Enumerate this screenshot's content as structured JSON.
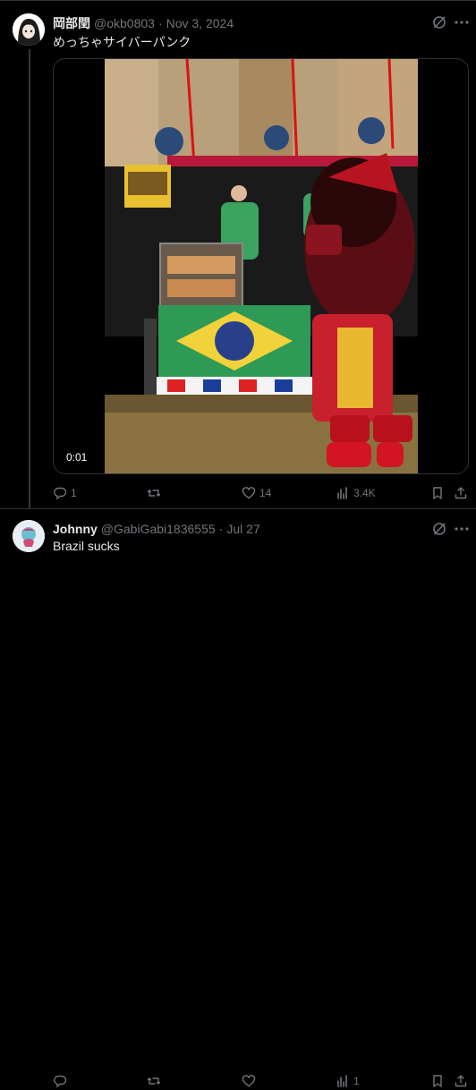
{
  "post1": {
    "name": "岡部閏",
    "handle": "@okb0803",
    "sep": "·",
    "date": "Nov 3, 2024",
    "text": "めっちゃサイバーパンク",
    "video": {
      "timestamp": "0:01",
      "description_icon": "video-thumbnail"
    },
    "actions": {
      "reply": "1",
      "repost": "",
      "like": "14",
      "views": "3.4K"
    }
  },
  "post2": {
    "name": "Johnny",
    "handle": "@GabiGabi1836555",
    "sep": "·",
    "date": "Jul 27",
    "text": "Brazil sucks",
    "actions": {
      "reply": "",
      "repost": "",
      "like": "",
      "views": "1"
    }
  },
  "colors": {
    "background": "#000000",
    "text": "#e7e9ea",
    "muted": "#71767b",
    "border": "#2f3336"
  }
}
